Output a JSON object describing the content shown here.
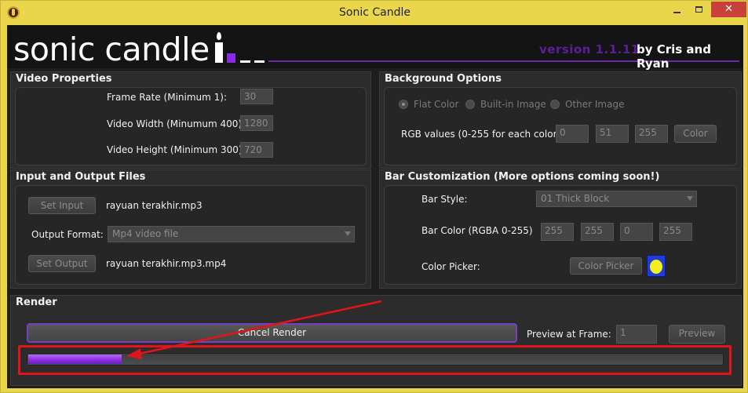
{
  "window": {
    "title": "Sonic Candle",
    "minimize": "minimize-icon",
    "maximize": "maximize-icon",
    "close": "✕"
  },
  "header": {
    "logo": "sonic candle",
    "version": "version 1.1.11",
    "authors": "by Cris and Ryan",
    "accent_color": "#8a2be2"
  },
  "video_properties": {
    "title": "Video Properties",
    "frame_rate_label": "Frame Rate (Minimum 1):",
    "frame_rate_value": "30",
    "width_label": "Video Width (Minumum 400):",
    "width_value": "1280",
    "height_label": "Video Height (Minimum 300):",
    "height_value": "720"
  },
  "background_options": {
    "title": "Background Options",
    "radio_flat": "Flat Color",
    "radio_builtin": "Built-in Image",
    "radio_other": "Other Image",
    "selected": "Flat Color",
    "rgb_label": "RGB values (0-255 for each color):",
    "r": "0",
    "g": "51",
    "b": "255",
    "color_button": "Color"
  },
  "io_files": {
    "title": "Input and Output Files",
    "set_input_button": "Set Input",
    "input_file": "rayuan terakhir.mp3",
    "output_format_label": "Output Format:",
    "output_format_value": "Mp4 video file",
    "set_output_button": "Set Output",
    "output_file": "rayuan terakhir.mp3.mp4"
  },
  "bar_customization": {
    "title": "Bar Customization (More options coming soon!)",
    "bar_style_label": "Bar Style:",
    "bar_style_value": "01 Thick Block",
    "bar_color_label": "Bar Color (RGBA 0-255)",
    "r": "255",
    "g": "255",
    "b": "0",
    "a": "255",
    "color_picker_label": "Color Picker:",
    "color_picker_button": "Color Picker",
    "swatch_color": "#1d3cd8",
    "swatch_dot_color": "#f3ee1e"
  },
  "render": {
    "title": "Render",
    "cancel_button": "Cancel Render",
    "preview_label": "Preview at Frame:",
    "preview_frame": "1",
    "preview_button": "Preview",
    "progress_fraction": 0.135,
    "annotation_color": "#e0141a"
  }
}
